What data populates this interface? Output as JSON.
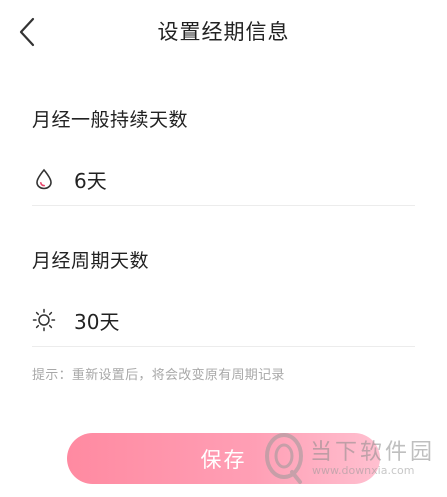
{
  "header": {
    "title": "设置经期信息",
    "back_icon": "chevron-left-icon"
  },
  "period_length": {
    "label": "月经一般持续天数",
    "icon": "drop-icon",
    "value": "6天"
  },
  "cycle_length": {
    "label": "月经周期天数",
    "icon": "sun-icon",
    "value": "30天"
  },
  "tip": "提示：重新设置后，将会改变原有周期记录",
  "save_button": {
    "label": "保存"
  },
  "watermark": {
    "text": "当下软件园",
    "url": "www.downxia.com"
  },
  "colors": {
    "accent_start": "#ff8aa1",
    "accent_end": "#ffc0d0",
    "drop_accent": "#e8456b",
    "tip_text": "#a8a8a8"
  }
}
